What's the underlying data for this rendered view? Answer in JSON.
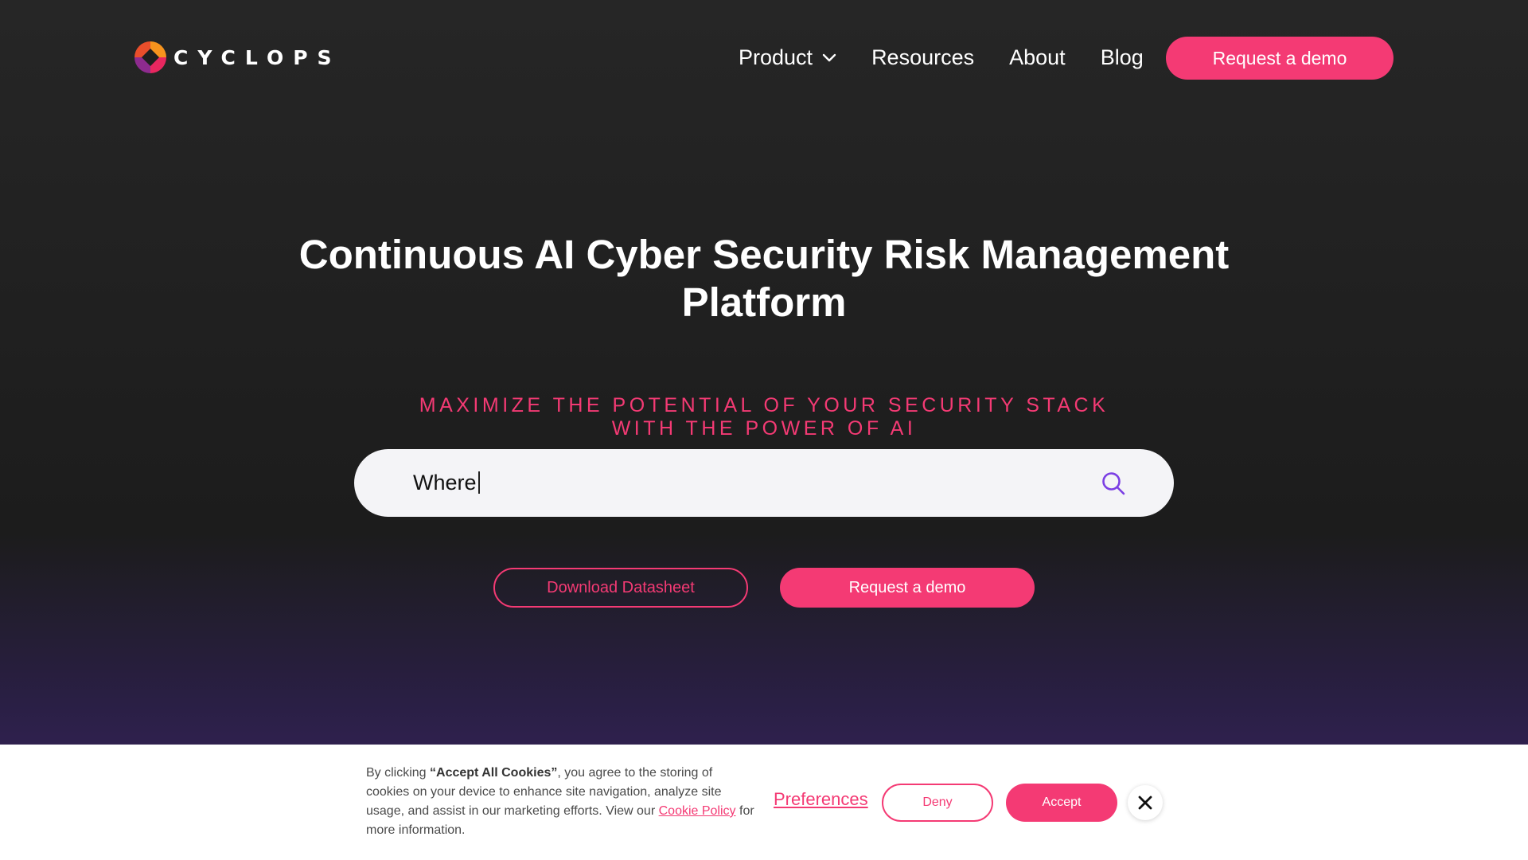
{
  "brand": {
    "name": "CYCLOPS",
    "accent": "#f43a74",
    "logo_icon": "cyclops-logo-icon"
  },
  "nav": {
    "items": [
      {
        "label": "Product",
        "icon": "chevron-down-icon"
      },
      {
        "label": "Resources"
      },
      {
        "label": "About"
      },
      {
        "label": "Blog"
      }
    ],
    "cta_label": "Request a demo"
  },
  "hero": {
    "title": "Continuous AI Cyber Security Risk Management Platform",
    "subtitle_line1": "MAXIMIZE THE POTENTIAL OF YOUR SECURITY STACK",
    "subtitle_line2": "WITH THE POWER OF AI",
    "search": {
      "value": "Where",
      "icon": "search-icon"
    },
    "download_label": "Download Datasheet",
    "demo_label": "Request a demo"
  },
  "cookie_banner": {
    "text_prefix": "By clicking ",
    "text_strong": "“Accept All Cookies”",
    "text_middle": ", you agree to the storing of cookies on your device to enhance site navigation, analyze site usage, and assist in our marketing efforts. View our ",
    "policy_link": "Cookie Policy",
    "text_suffix": " for more information.",
    "preferences_label": "Preferences",
    "deny_label": "Deny",
    "accept_label": "Accept",
    "close_icon": "close-icon"
  }
}
